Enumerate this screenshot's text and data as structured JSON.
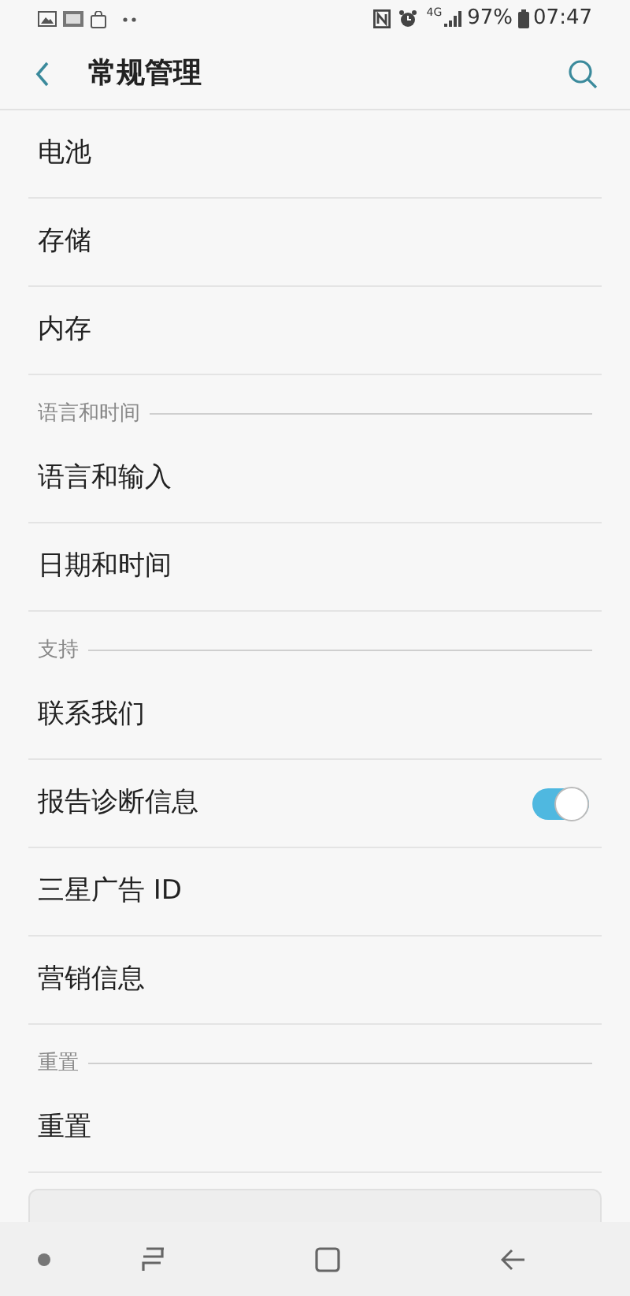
{
  "status_bar": {
    "network": "4G",
    "battery": "97%",
    "time": "07:47"
  },
  "header": {
    "title": "常规管理"
  },
  "items": [
    {
      "kind": "row",
      "label": "电池"
    },
    {
      "kind": "row",
      "label": "存储"
    },
    {
      "kind": "row",
      "label": "内存"
    },
    {
      "kind": "section",
      "label": "语言和时间"
    },
    {
      "kind": "row",
      "label": "语言和输入"
    },
    {
      "kind": "row",
      "label": "日期和时间"
    },
    {
      "kind": "section",
      "label": "支持"
    },
    {
      "kind": "row",
      "label": "联系我们"
    },
    {
      "kind": "toggle",
      "label": "报告诊断信息",
      "on": true
    },
    {
      "kind": "row",
      "label": "三星广告 ID"
    },
    {
      "kind": "row",
      "label": "营销信息"
    },
    {
      "kind": "section",
      "label": "重置"
    },
    {
      "kind": "row",
      "label": "重置"
    }
  ]
}
